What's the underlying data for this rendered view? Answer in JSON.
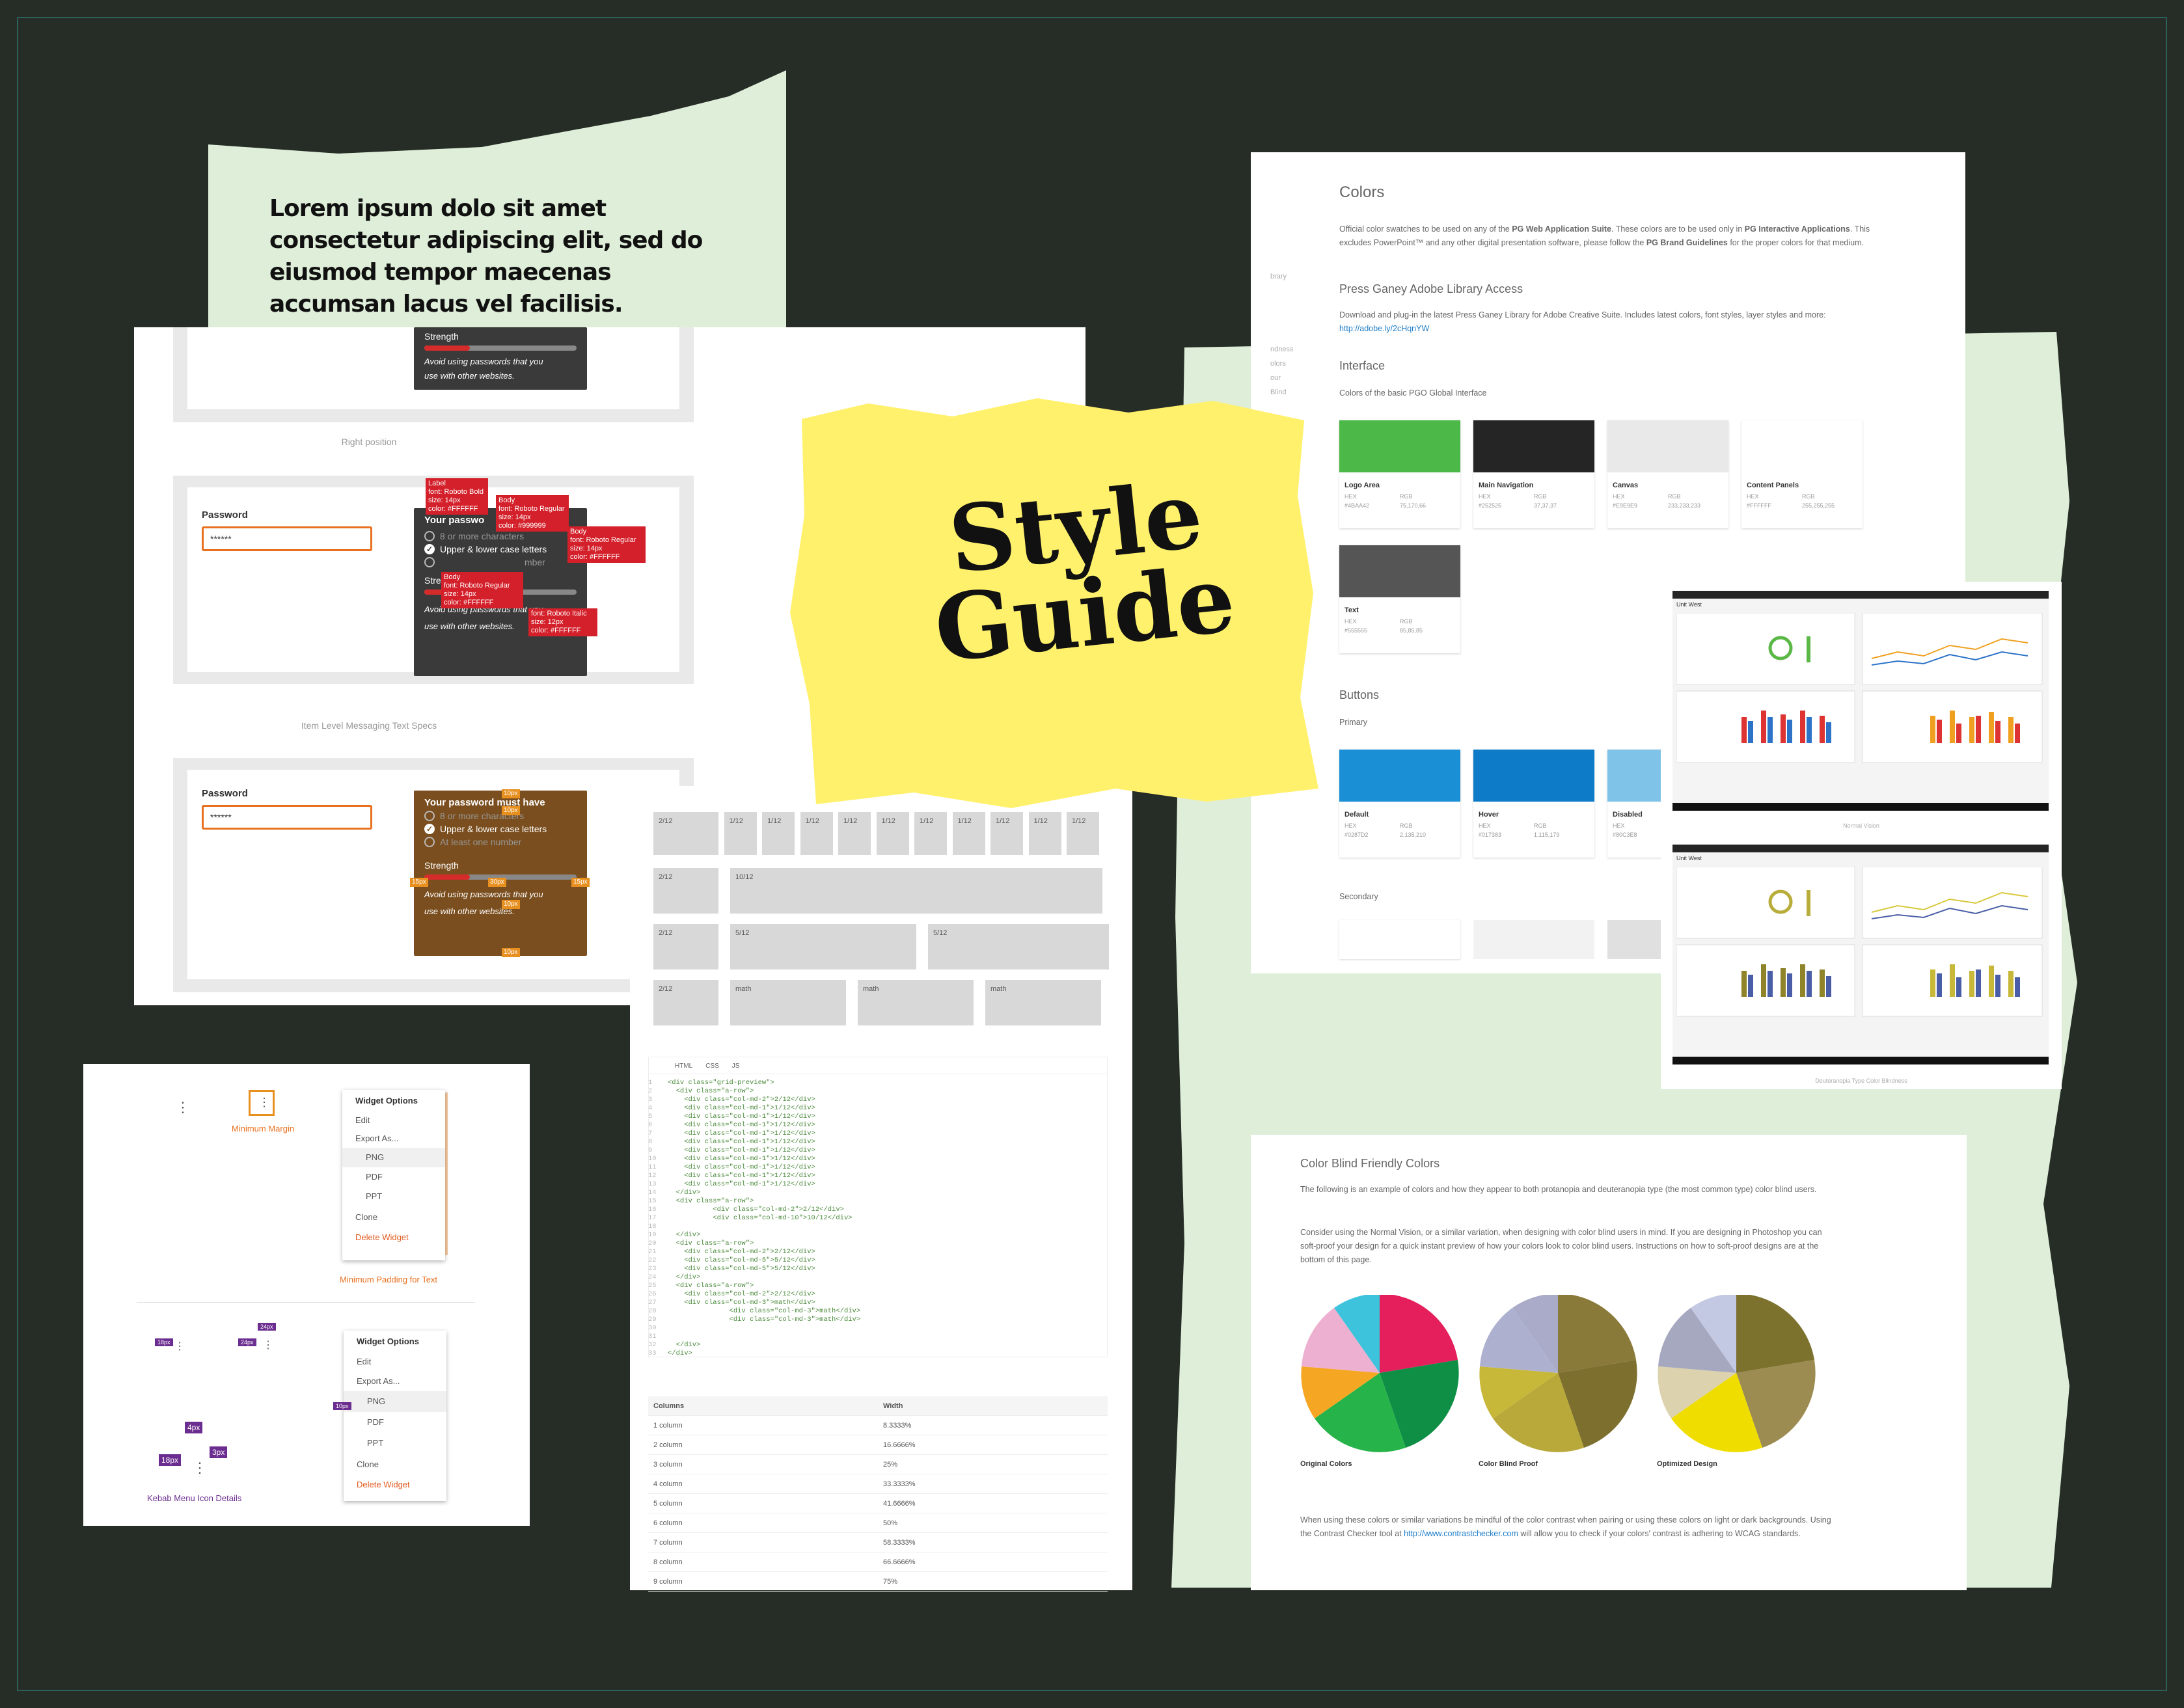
{
  "hero_text": "Lorem ipsum dolo sit amet consectetur adipiscing elit, sed do eiusmod tempor maecenas accumsan lacus vel facilisis.",
  "badge": {
    "line1": "Style",
    "line2": "Guide"
  },
  "password": {
    "label": "Password",
    "value": "******",
    "title": "Your password must have",
    "title_short": "Your passwo",
    "req1": "8 or more characters",
    "req2": "Upper & lower case letters",
    "req3": "At least one number",
    "req3_partial": "mber",
    "strength": "Strength",
    "hint_line1": "Avoid using passwords that you",
    "hint_line2": "use with other websites.",
    "caption_right": "Right position",
    "caption_specs": "Item Level Messaging Text Specs",
    "specs": {
      "label": "Label\nfont: Roboto Bold\nsize: 14px\ncolor: #FFFFFF",
      "body1": "Body\nfont: Roboto Regular\nsize: 14px\ncolor: #999999",
      "body2": "Body\nfont: Roboto Regular\nsize: 14px\ncolor: #FFFFFF",
      "body3": "Body\nfont: Roboto Regular\nsize: 14px\ncolor: #FFFFFF",
      "italic": "font: Roboto Italic\nsize: 12px\ncolor: #FFFFFF"
    },
    "chips": {
      "p10": "10px",
      "p15": "15px",
      "p30": "30px"
    }
  },
  "grid": {
    "row1": [
      "2/12",
      "1/12",
      "1/12",
      "1/12",
      "1/12",
      "1/12",
      "1/12",
      "1/12",
      "1/12",
      "1/12",
      "1/12"
    ],
    "row2": [
      "2/12",
      "10/12"
    ],
    "row3": [
      "2/12",
      "5/12",
      "5/12"
    ],
    "row4": [
      "2/12",
      "math",
      "math",
      "math"
    ],
    "tabs": [
      "HTML",
      "CSS",
      "JS"
    ],
    "code": [
      "<div class=\"grid-preview\">",
      "  <div class=\"a-row\">",
      "    <div class=\"col-md-2\">2/12</div>",
      "    <div class=\"col-md-1\">1/12</div>",
      "    <div class=\"col-md-1\">1/12</div>",
      "    <div class=\"col-md-1\">1/12</div>",
      "    <div class=\"col-md-1\">1/12</div>",
      "    <div class=\"col-md-1\">1/12</div>",
      "    <div class=\"col-md-1\">1/12</div>",
      "    <div class=\"col-md-1\">1/12</div>",
      "    <div class=\"col-md-1\">1/12</div>",
      "    <div class=\"col-md-1\">1/12</div>",
      "    <div class=\"col-md-1\">1/12</div>",
      "  </div>",
      "  <div class=\"a-row\">",
      "           <div class=\"col-md-2\">2/12</div>",
      "           <div class=\"col-md-10\">10/12</div>",
      "",
      "  </div>",
      "  <div class=\"a-row\">",
      "    <div class=\"col-md-2\">2/12</div>",
      "    <div class=\"col-md-5\">5/12</div>",
      "    <div class=\"col-md-5\">5/12</div>",
      "  </div>",
      "  <div class=\"a-row\">",
      "    <div class=\"col-md-2\">2/12</div>",
      "    <div class=\"col-md-3\">math</div>",
      "               <div class=\"col-md-3\">math</div>",
      "               <div class=\"col-md-3\">math</div>",
      "",
      "",
      "  </div>",
      "</div>"
    ],
    "table_headers": [
      "Columns",
      "Width"
    ],
    "table_rows": [
      [
        "1 column",
        "8.3333%"
      ],
      [
        "2 column",
        "16.6666%"
      ],
      [
        "3 column",
        "25%"
      ],
      [
        "4 column",
        "33.3333%"
      ],
      [
        "5 column",
        "41.6666%"
      ],
      [
        "6 column",
        "50%"
      ],
      [
        "7 column",
        "58.3333%"
      ],
      [
        "8 column",
        "66.6666%"
      ],
      [
        "9 column",
        "75%"
      ]
    ]
  },
  "menu_panel": {
    "min_margin": "Minimum Margin",
    "min_padding": "Minimum Padding for Text",
    "kebab_details": "Kebab Menu Icon Details",
    "menu": {
      "title": "Widget Options",
      "edit": "Edit",
      "export": "Export As...",
      "png": "PNG",
      "pdf": "PDF",
      "ppt": "PPT",
      "clone": "Clone",
      "delete": "Delete Widget"
    },
    "chips": {
      "c4": "4px",
      "c18": "18px",
      "c3": "3px",
      "c24": "24px",
      "c10": "10px"
    }
  },
  "colors_doc": {
    "title": "Colors",
    "intro_a": "Official color swatches to be used on any of the ",
    "intro_b": "PG Web Application Suite",
    "intro_c": ". These colors are to be used only in ",
    "intro_d": "PG Interactive Applications",
    "intro_e": ". This excludes PowerPoint™ and any other digital presentation software, please follow the ",
    "intro_f": "PG Brand Guidelines",
    "intro_g": " for the proper colors for that medium.",
    "adobe_title": "Press Ganey Adobe Library Access",
    "adobe_text": "Download and plug-in the latest Press Ganey Library for Adobe Creative Suite. Includes latest colors, font styles, layer styles and more: ",
    "adobe_link": "http://adobe.ly/2cHqnYW",
    "interface_title": "Interface",
    "interface_sub": "Colors of the basic PGO Global Interface",
    "buttons_title": "Buttons",
    "primary": "Primary",
    "secondary": "Secondary",
    "hex_label": "HEX",
    "rgb_label": "RGB",
    "side_frags": [
      "brary",
      "ndness",
      "olors",
      "our",
      "Blind"
    ],
    "swatches": [
      {
        "name": "Logo Area",
        "hex": "#4BAA42",
        "rgb": "75,170,66",
        "color": "#4bb847"
      },
      {
        "name": "Main Navigation",
        "hex": "#252525",
        "rgb": "37,37,37",
        "color": "#252525"
      },
      {
        "name": "Canvas",
        "hex": "#E9E9E9",
        "rgb": "233,233,233",
        "color": "#e9e9e9"
      },
      {
        "name": "Content Panels",
        "hex": "#FFFFFF",
        "rgb": "255,255,255",
        "color": "#ffffff"
      },
      {
        "name": "Text",
        "hex": "#555555",
        "rgb": "85,85,85",
        "color": "#555555"
      }
    ],
    "buttons": [
      {
        "name": "Default",
        "hex": "#0287D2",
        "rgb": "2,135,210",
        "color": "#1b8fd6"
      },
      {
        "name": "Hover",
        "hex": "#017383",
        "rgb": "1,115,179",
        "color": "#0e7bc8"
      },
      {
        "name": "Disabled",
        "hex": "#80C3E8",
        "rgb": "",
        "color": "#80c3e8"
      }
    ]
  },
  "dashboards": {
    "label1": "Normal Vision",
    "label2": "Deuteranopia Type Color Blindness",
    "unit": "Unit West"
  },
  "color_blind": {
    "title": "Color Blind Friendly Colors",
    "p1": "The following is an example of colors and how they appear to both protanopia and deuteranopia type (the most common type) color blind users.",
    "p2": "Consider using the Normal Vision, or a similar variation, when designing with color blind users in mind. If you are designing in Photoshop you can soft-proof your design for a quick instant preview of how your colors look to color blind users. Instructions on how to soft-proof designs are at the bottom of this page.",
    "pie_labels": [
      "Original Colors",
      "Color Blind Proof",
      "Optimized Design"
    ],
    "p3a": "When using these colors or similar variations be mindful of the color contrast when pairing or using these colors on light or dark backgrounds. Using the Contrast Checker tool at ",
    "p3link": "http://www.contrastchecker.com",
    "p3b": " will allow you to check if your colors' contrast is adhering to WCAG standards."
  },
  "colors": {
    "accent_orange": "#e8701f",
    "spec_red": "#d3202a",
    "kebab_purple": "#6b2d8f",
    "badge_yellow": "#fff16c",
    "mint": "#deeed8",
    "background": "#262c26"
  }
}
